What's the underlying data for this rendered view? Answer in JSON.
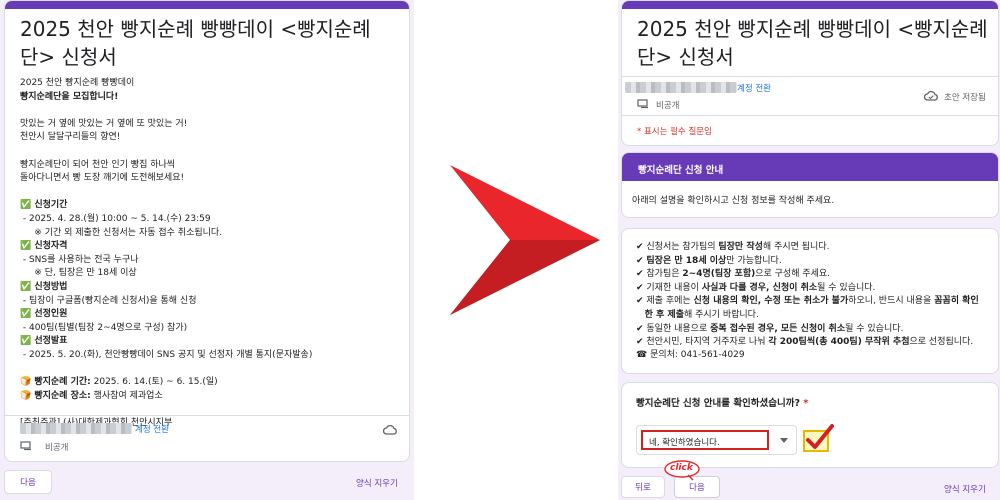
{
  "left_form": {
    "title_line1": "2025 천안 빵지순례 빵빵데이 <빵지순례",
    "title_line2": "단> 신청서",
    "intro": [
      "2025 천안 빵지순례 빵빵데이",
      "빵지순례단을 모집합니다!"
    ],
    "slogan": [
      "맛있는 거 옆에 맛있는 거 옆에 또 맛있는 거!",
      "천안시 달달구리들의 향연!"
    ],
    "invite": [
      "빵지순례단이 되어 천안 인기 빵집 하나씩",
      "돌아다니면서 빵 도장 깨기에 도전해보세요!"
    ],
    "sections": [
      {
        "head": "✅ 신청기간",
        "lines": [
          " - 2025. 4. 28.(월) 10:00 ~ 5. 14.(수) 23:59",
          "     ※ 기간 외 제출한 신청서는 자동 접수 취소됩니다."
        ]
      },
      {
        "head": "✅ 신청자격",
        "lines": [
          " - SNS를 사용하는 전국 누구나",
          "     ※ 단, 팀장은 만 18세 이상"
        ]
      },
      {
        "head": "✅ 신청방법",
        "lines": [
          " - 팀장이 구글폼(빵지순례 신청서)을 통해 신청"
        ]
      },
      {
        "head": "✅ 선정인원",
        "lines": [
          " - 400팀(팀별(팀장 2~4명으로 구성) 참가)"
        ]
      },
      {
        "head": "✅ 선정발표",
        "lines": [
          " - 2025. 5. 20.(화), 천안빵빵데이 SNS 공지 및 선정자 개별 통지(문자발송)"
        ]
      }
    ],
    "period_label": "🍞 빵지순례 기간:",
    "period_value": " 2025. 6. 14.(토) ~ 6. 15.(일)",
    "place_label": "🍞 빵지순례 장소:",
    "place_value": " 행사참여 제과업소",
    "organizer": "[주최주관] (사)대한제과협회 천안시지부",
    "switch_account": "계정 전환",
    "not_shared": "비공개",
    "next_button": "다음",
    "clear_form": "양식 지우기"
  },
  "right_form": {
    "title_line1": "2025 천안 빵지순례 빵빵데이 <빵지순례",
    "title_line2": "단> 신청서",
    "switch_account": "계정 전환",
    "not_shared": "비공개",
    "saved": "초안 저장됨",
    "required_note": "* 표시는 필수 질문임",
    "section_title": "빵지순례단 신청 안내",
    "section_desc": "아래의 설명을 확인하시고 신청 정보를 작성해 주세요.",
    "notice": [
      {
        "parts": [
          {
            "t": "✔ 신청서는 참가팀의 "
          },
          {
            "t": "팀장만 작성",
            "b": true
          },
          {
            "t": "해 주시면 됩니다."
          }
        ]
      },
      {
        "parts": [
          {
            "t": "✔ "
          },
          {
            "t": "팀장은 만 18세 이상",
            "b": true
          },
          {
            "t": "만 가능합니다."
          }
        ]
      },
      {
        "parts": [
          {
            "t": "✔ 참가팀은 "
          },
          {
            "t": "2~4명(팀장 포함)",
            "b": true
          },
          {
            "t": "으로 구성해 주세요."
          }
        ]
      },
      {
        "parts": [
          {
            "t": "✔ 기재한 내용이 "
          },
          {
            "t": "사실과 다를 경우, 신청이 취소",
            "b": true
          },
          {
            "t": "될 수 있습니다."
          }
        ]
      },
      {
        "parts": [
          {
            "t": "✔ 제출 후에는 "
          },
          {
            "t": "신청 내용의 확인, 수정 또는 취소가 불가",
            "b": true
          },
          {
            "t": "하오니, 반드시 내용을 "
          },
          {
            "t": "꼼꼼히 확인",
            "b": true
          }
        ]
      },
      {
        "parts": [
          {
            "t": "   "
          },
          {
            "t": "한 후 제출",
            "b": true
          },
          {
            "t": "해 주시기 바랍니다."
          }
        ]
      },
      {
        "parts": [
          {
            "t": "✔ 동일한 내용으로 "
          },
          {
            "t": "중복 접수된 경우, 모든 신청이 취소",
            "b": true
          },
          {
            "t": "될 수 있습니다."
          }
        ]
      },
      {
        "parts": [
          {
            "t": "✔ 천안시민, 타지역 거주자로 나눠 "
          },
          {
            "t": "각 200팀씩(총 400팀) 무작위 추첨",
            "b": true
          },
          {
            "t": "으로 선정됩니다."
          }
        ]
      }
    ],
    "contact": "☎ 문의처: 041-561-4029",
    "question": "빵지순례단 신청 안내를 확인하셨습니까?",
    "required_mark": "*",
    "answer": "네, 확인하였습니다.",
    "back_button": "뒤로",
    "next_button": "다음",
    "click_label": "click",
    "clear_form": "양식 지우기"
  },
  "colors": {
    "accent": "#673ab7",
    "highlight": "#d32020",
    "arrow": "#e8262b"
  }
}
